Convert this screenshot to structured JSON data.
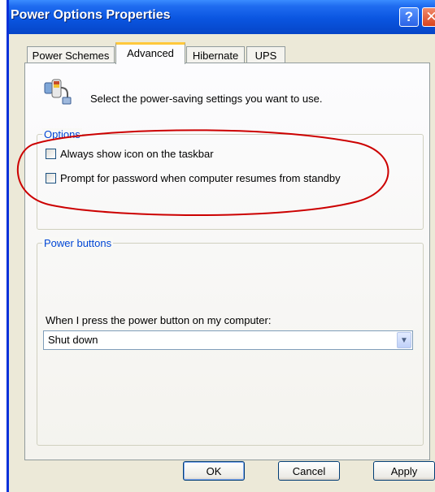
{
  "window": {
    "title": "Power Options Properties",
    "help_glyph": "?",
    "close_glyph": "✕"
  },
  "tabs": [
    {
      "label": "Power Schemes",
      "active": false
    },
    {
      "label": "Advanced",
      "active": true
    },
    {
      "label": "Hibernate",
      "active": false
    },
    {
      "label": "UPS",
      "active": false
    }
  ],
  "header": {
    "icon": "power-plug-icon",
    "text": "Select the power-saving settings you want to use."
  },
  "options": {
    "legend": "Options",
    "items": [
      {
        "label": "Always show icon on the taskbar",
        "checked": false
      },
      {
        "label": "Prompt for password when computer resumes from standby",
        "checked": false
      }
    ]
  },
  "power_buttons": {
    "legend": "Power buttons",
    "press_label": "When I press the power button on my computer:",
    "selected": "Shut down"
  },
  "buttons": {
    "ok": "OK",
    "cancel": "Cancel",
    "apply": "Apply"
  },
  "colors": {
    "titlebar": "#0A55E0",
    "legend_text": "#0046D5",
    "annotation": "#CC0000",
    "active_tab_accent": "#FFC83C"
  }
}
